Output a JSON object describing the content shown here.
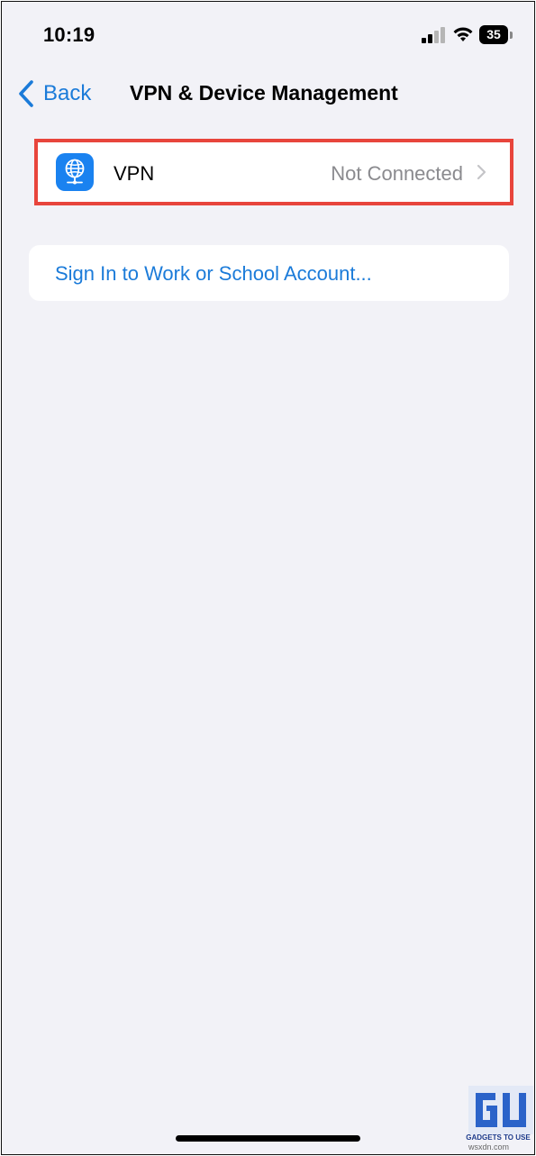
{
  "status_bar": {
    "time": "10:19",
    "battery_level": "35",
    "icons": [
      "signal-icon",
      "wifi-icon",
      "battery-icon"
    ]
  },
  "nav": {
    "back_label": "Back",
    "title": "VPN & Device Management"
  },
  "vpn_row": {
    "label": "VPN",
    "status": "Not Connected",
    "icon": "globe-network-icon"
  },
  "signin": {
    "label": "Sign In to Work or School Account..."
  },
  "colors": {
    "background": "#f2f2f7",
    "accent": "#1b7bd9",
    "highlight": "#e8453c",
    "vpn_icon_bg": "#1a82f0",
    "secondary_text": "#8a8a8e"
  },
  "watermark": {
    "brand": "GADGETS TO USE",
    "site": "wsxdn.com"
  }
}
